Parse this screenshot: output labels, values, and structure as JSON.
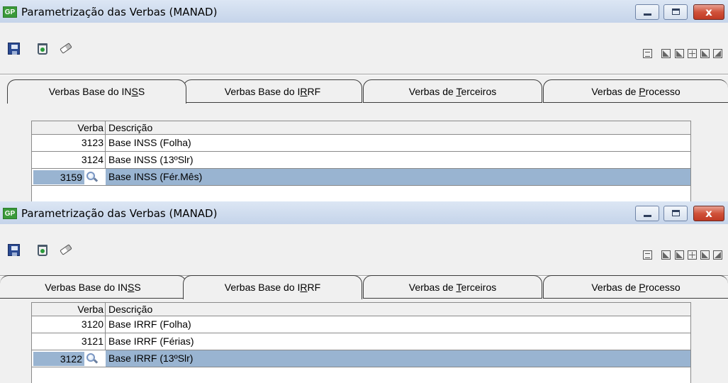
{
  "window": {
    "app_icon": "GP",
    "title": "Parametrização das Verbas (MANAD)",
    "close_glyph": "x"
  },
  "toolbar": {
    "left_icons": [
      "save-icon",
      "recycle-bin-icon",
      "eraser-icon"
    ],
    "right_icons": [
      "list-icon",
      "nav-first-icon",
      "nav-prev-icon",
      "expand-icon",
      "nav-next-icon",
      "nav-last-icon"
    ]
  },
  "tabs": [
    {
      "label": "Verbas Base do INSS",
      "mnemonic_index": 17
    },
    {
      "label": "Verbas Base do IRRF",
      "mnemonic_index": 16
    },
    {
      "label": "Verbas de Terceiros",
      "mnemonic_index": 10
    },
    {
      "label": "Verbas de Processo",
      "mnemonic_index": 10
    }
  ],
  "grid_headers": {
    "verba": "Verba",
    "descricao": "Descrição"
  },
  "screens": [
    {
      "active_tab": 0,
      "rows": [
        {
          "verba": "3123",
          "descricao": "Base INSS (Folha)",
          "selected": false
        },
        {
          "verba": "3124",
          "descricao": "Base INSS (13ºSlr)",
          "selected": false
        },
        {
          "verba": "3159",
          "descricao": "Base INSS (Fér.Mês)",
          "selected": true
        }
      ]
    },
    {
      "active_tab": 1,
      "rows": [
        {
          "verba": "3120",
          "descricao": "Base IRRF (Folha)",
          "selected": false
        },
        {
          "verba": "3121",
          "descricao": "Base IRRF (Férias)",
          "selected": false
        },
        {
          "verba": "3122",
          "descricao": "Base IRRF (13ºSlr)",
          "selected": true
        }
      ]
    }
  ]
}
